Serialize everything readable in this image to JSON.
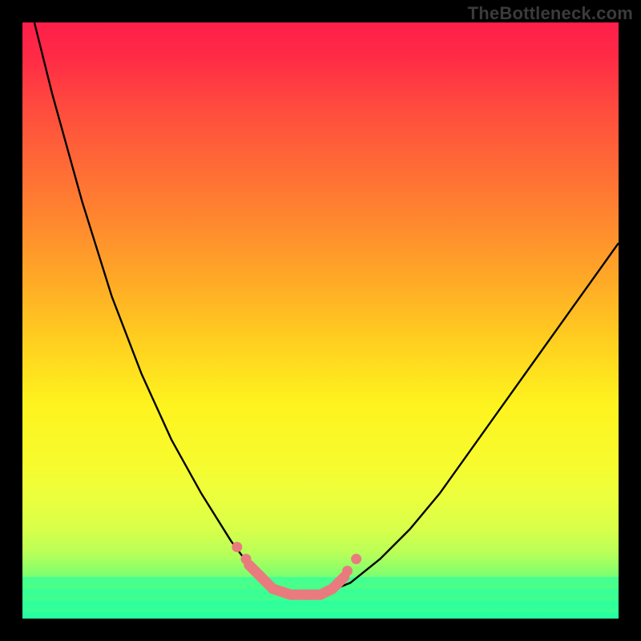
{
  "watermark": "TheBottleneck.com",
  "colors": {
    "frame": "#000000",
    "gradient_top": "#ff1e4a",
    "gradient_bottom": "#1dffaa",
    "curve_stroke": "#000000",
    "marker_stroke": "#e97b7f"
  },
  "chart_data": {
    "type": "line",
    "title": "",
    "xlabel": "",
    "ylabel": "",
    "xlim": [
      0,
      100
    ],
    "ylim": [
      0,
      100
    ],
    "series": [
      {
        "name": "bottleneck-curve",
        "x": [
          2,
          5,
          10,
          15,
          20,
          25,
          30,
          35,
          38,
          40,
          42,
          45,
          48,
          50,
          55,
          60,
          65,
          70,
          75,
          80,
          85,
          90,
          95,
          100
        ],
        "y": [
          100,
          88,
          70,
          54,
          41,
          30,
          21,
          13,
          9,
          7,
          5,
          4,
          4,
          4,
          6,
          10,
          15,
          21,
          28,
          35,
          42,
          49,
          56,
          63
        ]
      }
    ],
    "markers": {
      "name": "highlight-segment",
      "x": [
        38,
        40,
        42,
        45,
        48,
        50,
        52,
        54
      ],
      "y": [
        9,
        7,
        5,
        4,
        4,
        4,
        5,
        7
      ]
    },
    "annotations": []
  }
}
